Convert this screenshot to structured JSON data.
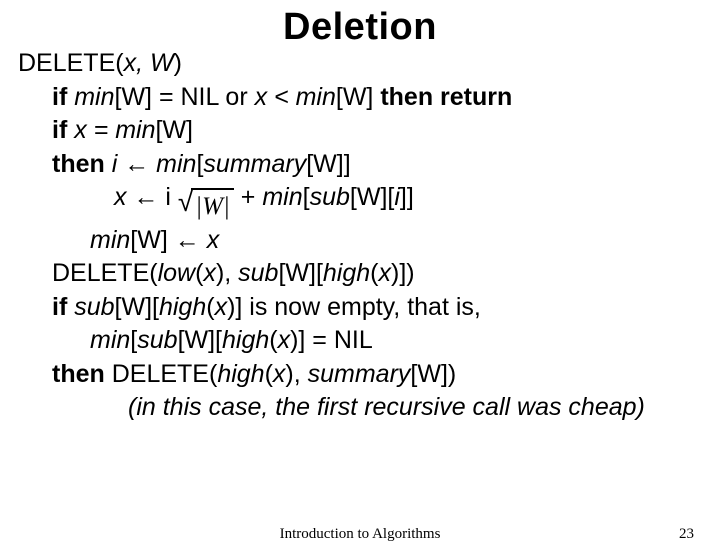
{
  "title": "Deletion",
  "lines": {
    "l1a": "DELETE(",
    "l1b": "x, W",
    "l1c": ")",
    "l2a": "if ",
    "l2b": "min",
    "l2c": "[W] = NIL or ",
    "l2d": "x < min",
    "l2e": "[W] ",
    "l2f": "then return",
    "l3a": "if ",
    "l3b": "x = min",
    "l3c": "[W]",
    "l4a": "then ",
    "l4b": "i ",
    "l4c": "← ",
    "l4d": "min",
    "l4e": "[",
    "l4f": "summary",
    "l4g": "[W]]",
    "l5a": "x ",
    "l5b": "← i ",
    "l5c": "|W|",
    "l5d": " + ",
    "l5e": "min",
    "l5f": "[",
    "l5g": "sub",
    "l5h": "[W][",
    "l5i": "i",
    "l5j": "]]",
    "l6a": "min",
    "l6b": "[W] ← ",
    "l6c": "x",
    "l7a": "DELETE(",
    "l7b": "low",
    "l7c": "(",
    "l7d": "x",
    "l7e": "), ",
    "l7f": "sub",
    "l7g": "[W][",
    "l7h": "high",
    "l7i": "(",
    "l7j": "x",
    "l7k": ")])",
    "l8a": "if ",
    "l8b": "sub",
    "l8c": "[W][",
    "l8d": "high",
    "l8e": "(",
    "l8f": "x",
    "l8g": ")] is now empty, that is,",
    "l9a": "min",
    "l9b": "[",
    "l9c": "sub",
    "l9d": "[W][",
    "l9e": "high",
    "l9f": "(",
    "l9g": "x",
    "l9h": ")] = NIL",
    "l10a": "then ",
    "l10b": "DELETE(",
    "l10c": "high",
    "l10d": "(",
    "l10e": "x",
    "l10f": "), ",
    "l10g": "summary",
    "l10h": "[W])",
    "l11": "(in this case, the first recursive call was cheap)"
  },
  "footer": {
    "center": "Introduction to Algorithms",
    "page": "23"
  }
}
